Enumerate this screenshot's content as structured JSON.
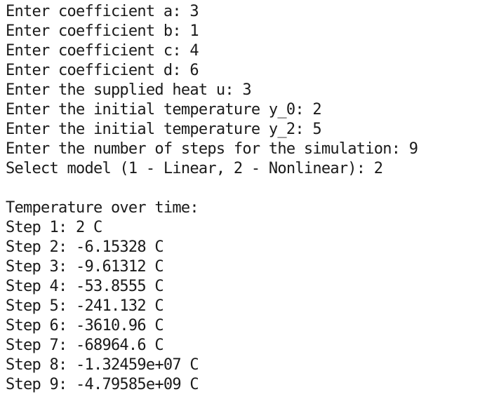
{
  "console": {
    "prompts": [
      "Enter coefficient a: 3",
      "Enter coefficient b: 1",
      "Enter coefficient c: 4",
      "Enter coefficient d: 6",
      "Enter the supplied heat u: 3",
      "Enter the initial temperature y_0: 2",
      "Enter the initial temperature y_2: 5",
      "Enter the number of steps for the simulation: 9",
      "Select model (1 - Linear, 2 - Nonlinear): 2"
    ],
    "results_header": "Temperature over time:",
    "steps": [
      "Step 1: 2 C",
      "Step 2: -6.15328 C",
      "Step 3: -9.61312 C",
      "Step 4: -53.8555 C",
      "Step 5: -241.132 C",
      "Step 6: -3610.96 C",
      "Step 7: -68964.6 C",
      "Step 8: -1.32459e+07 C",
      "Step 9: -4.79585e+09 C"
    ]
  }
}
